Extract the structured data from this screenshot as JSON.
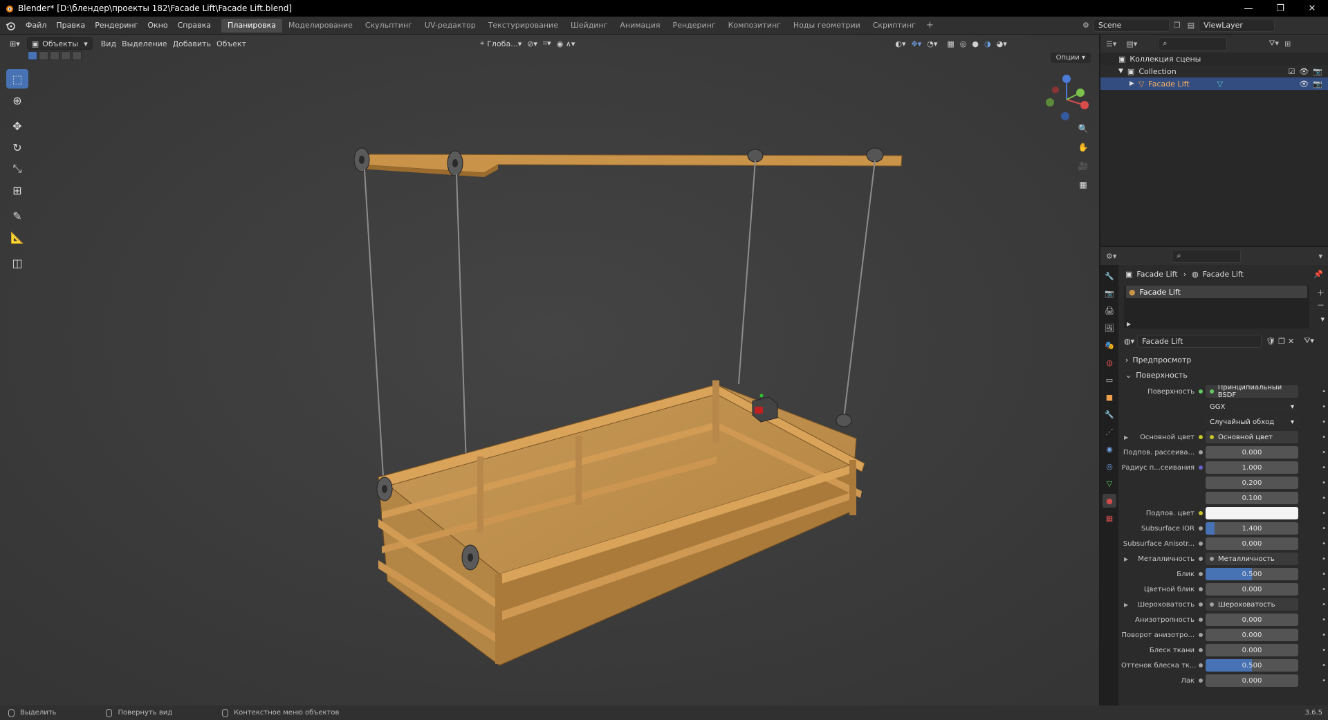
{
  "window": {
    "title": "Blender* [D:\\блендер\\проекты 182\\Facade Lift\\Facade Lift.blend]",
    "minimize": "—",
    "maximize": "❐",
    "close": "✕"
  },
  "menu": [
    "Файл",
    "Правка",
    "Рендеринг",
    "Окно",
    "Справка"
  ],
  "workspaces": [
    "Планировка",
    "Моделирование",
    "Скульптинг",
    "UV-редактор",
    "Текстурирование",
    "Шейдинг",
    "Анимация",
    "Рендеринг",
    "Композитинг",
    "Ноды геометрии",
    "Скриптинг"
  ],
  "workspace_active": "Планировка",
  "workspace_add": "+",
  "scene": {
    "name": "Scene",
    "view_layer": "ViewLayer"
  },
  "viewport": {
    "mode": "Объекты",
    "menus": [
      "Вид",
      "Выделение",
      "Добавить",
      "Объект"
    ],
    "orientation": "Глоба...",
    "options": "Опции"
  },
  "outliner": {
    "root": "Коллекция сцены",
    "collection": "Collection",
    "object": "Facade Lift"
  },
  "properties": {
    "breadcrumb_object": "Facade Lift",
    "breadcrumb_material": "Facade Lift",
    "slot": "Facade Lift",
    "material_name": "Facade Lift",
    "sections": {
      "preview": "Предпросмотр",
      "surface": "Поверхность"
    },
    "rows": [
      {
        "label": "Поверхность",
        "value": "Принципиальный BSDF",
        "kind": "dark",
        "socket": "#63c763"
      },
      {
        "label": "",
        "value": "GGX",
        "kind": "select",
        "socket": ""
      },
      {
        "label": "",
        "value": "Случайный обход",
        "kind": "select",
        "socket": ""
      },
      {
        "label": "Основной цвет",
        "value": "Основной цвет",
        "kind": "dark",
        "socket": "#c7c729",
        "expand": true
      },
      {
        "label": "Подпов. рассеива...",
        "value": "0.000",
        "kind": "num",
        "socket": "#a1a1a1",
        "fill": 0
      },
      {
        "label": "Радиус п...сеивания",
        "value": "1.000",
        "kind": "num",
        "socket": "#6363c7",
        "fill": 0
      },
      {
        "label": "",
        "value": "0.200",
        "kind": "num",
        "socket": "",
        "fill": 0
      },
      {
        "label": "",
        "value": "0.100",
        "kind": "num",
        "socket": "",
        "fill": 0
      },
      {
        "label": "Подпов. цвет",
        "value": "",
        "kind": "white",
        "socket": "#c7c729"
      },
      {
        "label": "Subsurface IOR",
        "value": "1.400",
        "kind": "num",
        "socket": "#a1a1a1",
        "fill": 0.1
      },
      {
        "label": "Subsurface Anisotr...",
        "value": "0.000",
        "kind": "num",
        "socket": "#a1a1a1",
        "fill": 0
      },
      {
        "label": "Металличность",
        "value": "Металличность",
        "kind": "dark",
        "socket": "#a1a1a1",
        "expand": true
      },
      {
        "label": "Блик",
        "value": "0.500",
        "kind": "num",
        "socket": "#a1a1a1",
        "fill": 0.5
      },
      {
        "label": "Цветной блик",
        "value": "0.000",
        "kind": "num",
        "socket": "#a1a1a1",
        "fill": 0
      },
      {
        "label": "Шероховатость",
        "value": "Шероховатость",
        "kind": "dark",
        "socket": "#a1a1a1",
        "expand": true
      },
      {
        "label": "Анизотропность",
        "value": "0.000",
        "kind": "num",
        "socket": "#a1a1a1",
        "fill": 0
      },
      {
        "label": "Поворот анизотро...",
        "value": "0.000",
        "kind": "num",
        "socket": "#a1a1a1",
        "fill": 0
      },
      {
        "label": "Блеск ткани",
        "value": "0.000",
        "kind": "num",
        "socket": "#a1a1a1",
        "fill": 0
      },
      {
        "label": "Оттенок блеска тк...",
        "value": "0.500",
        "kind": "num",
        "socket": "#a1a1a1",
        "fill": 0.5
      },
      {
        "label": "Лак",
        "value": "0.000",
        "kind": "num",
        "socket": "#a1a1a1",
        "fill": 0
      }
    ]
  },
  "status": {
    "select": "Выделить",
    "rotate": "Повернуть вид",
    "context": "Контекстное меню объектов",
    "version": "3.6.5"
  },
  "colors": {
    "accent": "#4772b3",
    "selected_row": "#334d80",
    "wood": "#c9934a",
    "viewport_bg": "#3c3c3c"
  }
}
